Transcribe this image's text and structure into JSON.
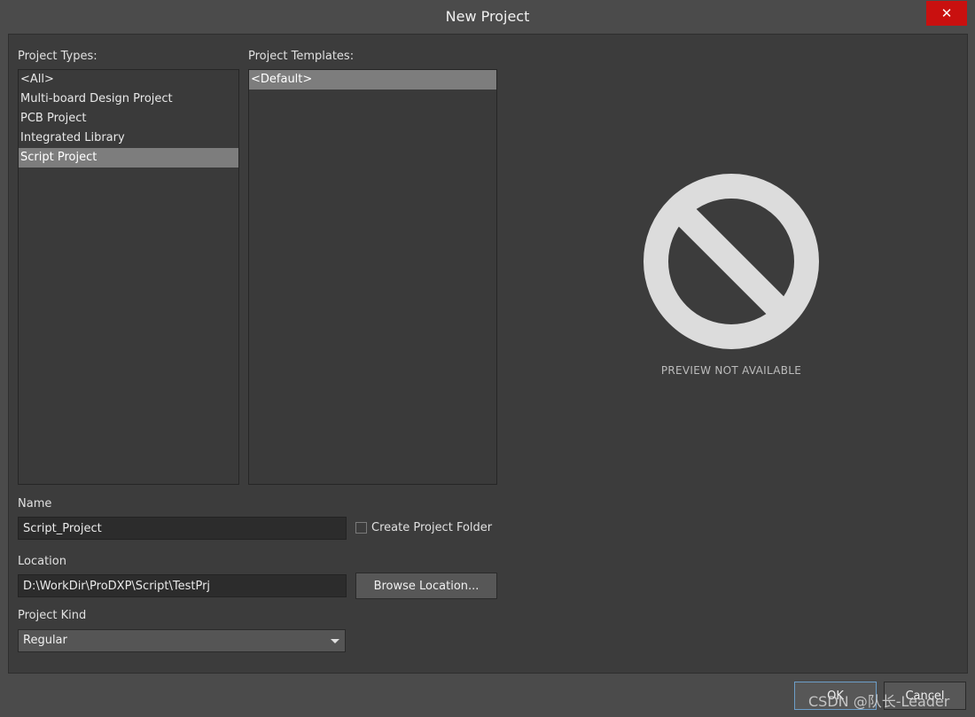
{
  "window": {
    "title": "New Project",
    "close_glyph": "✕"
  },
  "project_types": {
    "label": "Project Types:",
    "items": [
      {
        "label": "<All>"
      },
      {
        "label": "Multi-board Design Project"
      },
      {
        "label": "PCB Project"
      },
      {
        "label": "Integrated Library"
      },
      {
        "label": "Script Project"
      }
    ],
    "selected_index": 4
  },
  "project_templates": {
    "label": "Project Templates:",
    "items": [
      {
        "label": "<Default>"
      }
    ],
    "selected_index": 0
  },
  "preview": {
    "icon": "no-preview-icon",
    "text": "PREVIEW NOT AVAILABLE"
  },
  "name": {
    "label": "Name",
    "value": "Script_Project"
  },
  "create_folder": {
    "label": "Create Project Folder",
    "checked": false
  },
  "location": {
    "label": "Location",
    "value": "D:\\WorkDir\\ProDXP\\Script\\TestPrj",
    "browse_label": "Browse Location..."
  },
  "project_kind": {
    "label": "Project Kind",
    "value": "Regular"
  },
  "buttons": {
    "ok": "OK",
    "cancel": "Cancel"
  },
  "watermark": "CSDN @队长-Leader",
  "colors": {
    "close": "#c9100f",
    "selected_item": "#7d7d7d",
    "background": "#3c3c3c"
  }
}
